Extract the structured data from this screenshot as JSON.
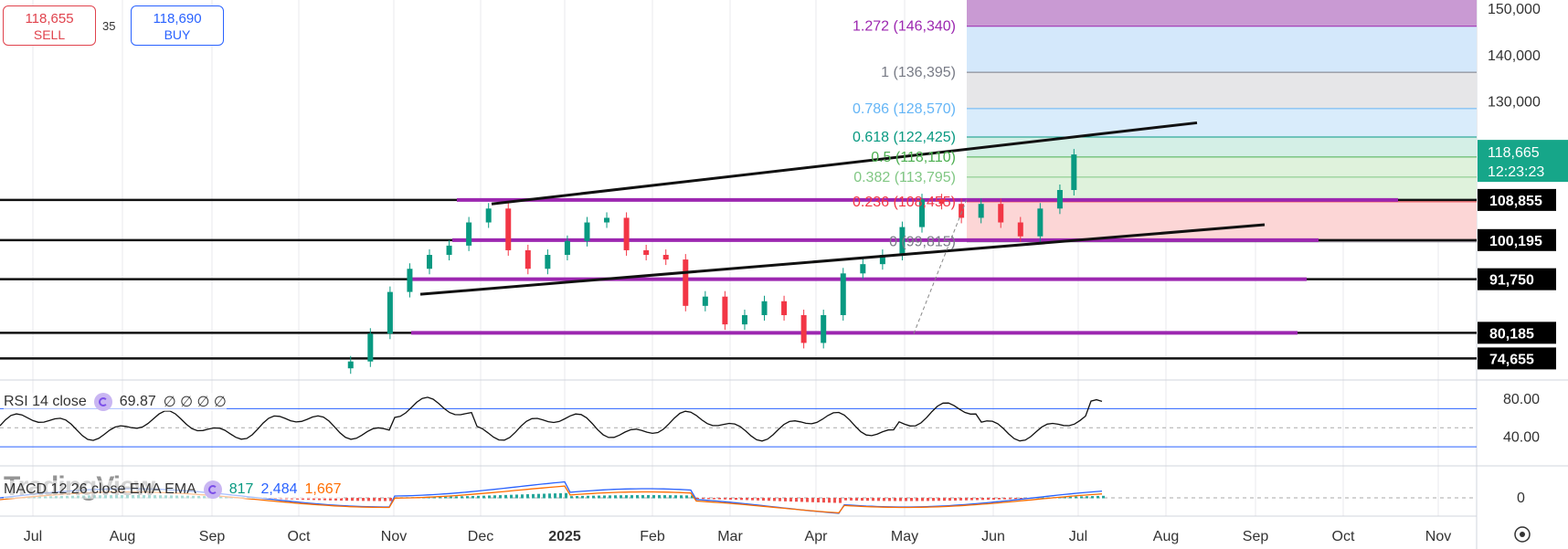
{
  "trade_panel": {
    "sell_price": "118,655",
    "sell_label": "SELL",
    "spread": "35",
    "buy_price": "118,690",
    "buy_label": "BUY"
  },
  "price_axis": {
    "ticks": [
      "150,000",
      "140,000",
      "130,000"
    ],
    "current_price": "118,665",
    "countdown": "12:23:23",
    "level_labels": [
      "108,855",
      "100,195",
      "91,750",
      "80,185",
      "74,655"
    ]
  },
  "fib_levels": [
    {
      "label": "1.272 (146,340)",
      "color": "#9c27b0"
    },
    {
      "label": "1 (136,395)",
      "color": "#787b86"
    },
    {
      "label": "0.786 (128,570)",
      "color": "#64b5f6"
    },
    {
      "label": "0.618 (122,425)",
      "color": "#089981"
    },
    {
      "label": "0.5 (118,110)",
      "color": "#4caf50"
    },
    {
      "label": "0.382 (113,795)",
      "color": "#81c784"
    },
    {
      "label": "0.236 (108,455)",
      "color": "#f23645"
    },
    {
      "label": "0 (99,815)",
      "color": "#787b86"
    }
  ],
  "rsi": {
    "title": "RSI 14 close",
    "value": "69.87",
    "extras": "∅ ∅ ∅ ∅",
    "ticks": [
      "80.00",
      "40.00"
    ]
  },
  "macd": {
    "title": "MACD 12 26 close EMA EMA",
    "v1": "817",
    "v2": "2,484",
    "v3": "1,667",
    "tick": "0"
  },
  "watermark": "TradingView",
  "time_axis": [
    "Jul",
    "Aug",
    "Sep",
    "Oct",
    "Nov",
    "Dec",
    "2025",
    "Feb",
    "Mar",
    "Apr",
    "May",
    "Jun",
    "Jul",
    "Aug",
    "Sep",
    "Oct",
    "Nov"
  ],
  "colors": {
    "up": "#089981",
    "down": "#f23645",
    "level": "#9c27b0",
    "rsi_band": "#2962ff"
  },
  "chart_data": {
    "type": "candlestick",
    "series": [
      {
        "name": "price",
        "points": [
          [
            "2024-10-30",
            74000
          ],
          [
            "2024-11-06",
            80000
          ],
          [
            "2024-11-13",
            89000
          ],
          [
            "2024-11-20",
            94000
          ],
          [
            "2024-11-27",
            97000
          ],
          [
            "2024-12-04",
            99000
          ],
          [
            "2024-12-11",
            104000
          ],
          [
            "2024-12-18",
            107000
          ],
          [
            "2024-12-25",
            98000
          ],
          [
            "2025-01-01",
            94000
          ],
          [
            "2025-01-08",
            97000
          ],
          [
            "2025-01-15",
            100000
          ],
          [
            "2025-01-22",
            104000
          ],
          [
            "2025-01-29",
            105000
          ],
          [
            "2025-02-05",
            98000
          ],
          [
            "2025-02-12",
            97000
          ],
          [
            "2025-02-19",
            96000
          ],
          [
            "2025-02-26",
            86000
          ],
          [
            "2025-03-05",
            88000
          ],
          [
            "2025-03-12",
            82000
          ],
          [
            "2025-03-19",
            84000
          ],
          [
            "2025-03-26",
            87000
          ],
          [
            "2025-04-02",
            84000
          ],
          [
            "2025-04-09",
            78000
          ],
          [
            "2025-04-16",
            84000
          ],
          [
            "2025-04-23",
            93000
          ],
          [
            "2025-04-30",
            95000
          ],
          [
            "2025-05-07",
            97000
          ],
          [
            "2025-05-14",
            103000
          ],
          [
            "2025-05-21",
            109000
          ],
          [
            "2025-05-28",
            108000
          ],
          [
            "2025-06-04",
            105000
          ],
          [
            "2025-06-11",
            108000
          ],
          [
            "2025-06-18",
            104000
          ],
          [
            "2025-06-25",
            101000
          ],
          [
            "2025-07-02",
            107000
          ],
          [
            "2025-07-09",
            111000
          ],
          [
            "2025-07-14",
            118665
          ]
        ]
      }
    ],
    "horizontal_levels": [
      108855,
      100195,
      91750,
      80185,
      74655
    ],
    "ylim": [
      70000,
      152000
    ]
  }
}
